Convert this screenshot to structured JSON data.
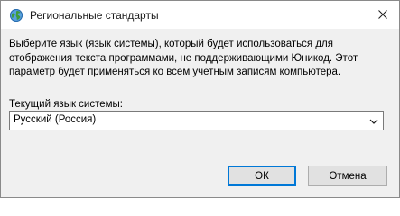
{
  "window": {
    "title": "Региональные стандарты",
    "title_icon": "globe-icon",
    "close_icon": "close-icon"
  },
  "content": {
    "description": "Выберите язык (язык системы), который будет использоваться для\nотображения текста программами, не поддерживающими Юникод. Этот\nпараметр будет применяться ко всем учетным записям компьютера.",
    "current_language_label": "Текущий язык системы:",
    "current_language_value": "Русский (Россия)"
  },
  "buttons": {
    "ok_label": "ОК",
    "cancel_label": "Отмена"
  },
  "colors": {
    "accent": "#0078d7",
    "dialog_bg": "#f0f0f0"
  }
}
